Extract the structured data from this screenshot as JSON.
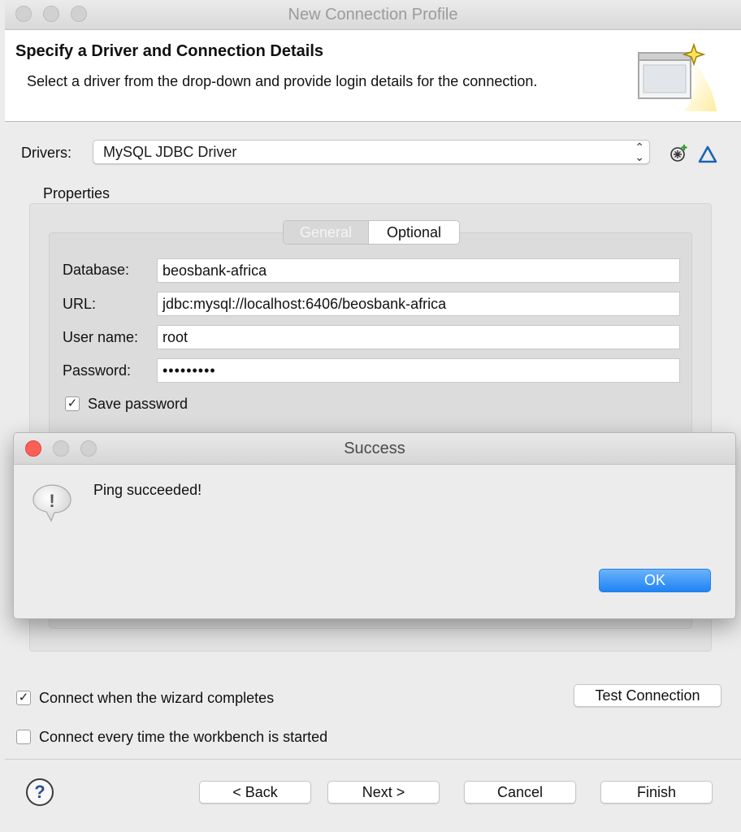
{
  "window": {
    "title": "New Connection Profile"
  },
  "header": {
    "title": "Specify a Driver and Connection Details",
    "description": "Select a driver from the drop-down and provide login details for the connection."
  },
  "drivers": {
    "label": "Drivers:",
    "selected": "MySQL JDBC Driver",
    "arrow": "⌃⌄"
  },
  "properties": {
    "label": "Properties",
    "tabs": [
      {
        "label": "General",
        "active": true
      },
      {
        "label": "Optional",
        "active": false
      }
    ],
    "fields": {
      "database": {
        "label": "Database:",
        "value": "beosbank-africa"
      },
      "url": {
        "label": "URL:",
        "value": "jdbc:mysql://localhost:6406/beosbank-africa"
      },
      "username": {
        "label": "User name:",
        "value": "root"
      },
      "password": {
        "label": "Password:",
        "value": "•••••••••"
      }
    },
    "save_password": {
      "label": "Save password",
      "checked": true,
      "mark": "✓"
    }
  },
  "options": {
    "connect_when_complete": {
      "label": "Connect when the wizard completes",
      "checked": true,
      "mark": "✓"
    },
    "connect_every_time": {
      "label": "Connect every time the workbench is started",
      "checked": false
    }
  },
  "test_connection_label": "Test Connection",
  "footer": {
    "help_icon": "?",
    "back_label": "< Back",
    "next_label": "Next >",
    "cancel_label": "Cancel",
    "finish_label": "Finish"
  },
  "dialog": {
    "title": "Success",
    "message": "Ping succeeded!",
    "icon_glyph": "!",
    "ok_label": "OK"
  },
  "colors": {
    "close_red": "#fc5f57",
    "ok_blue": "#1e83f5",
    "delta_blue": "#1a63b4"
  }
}
